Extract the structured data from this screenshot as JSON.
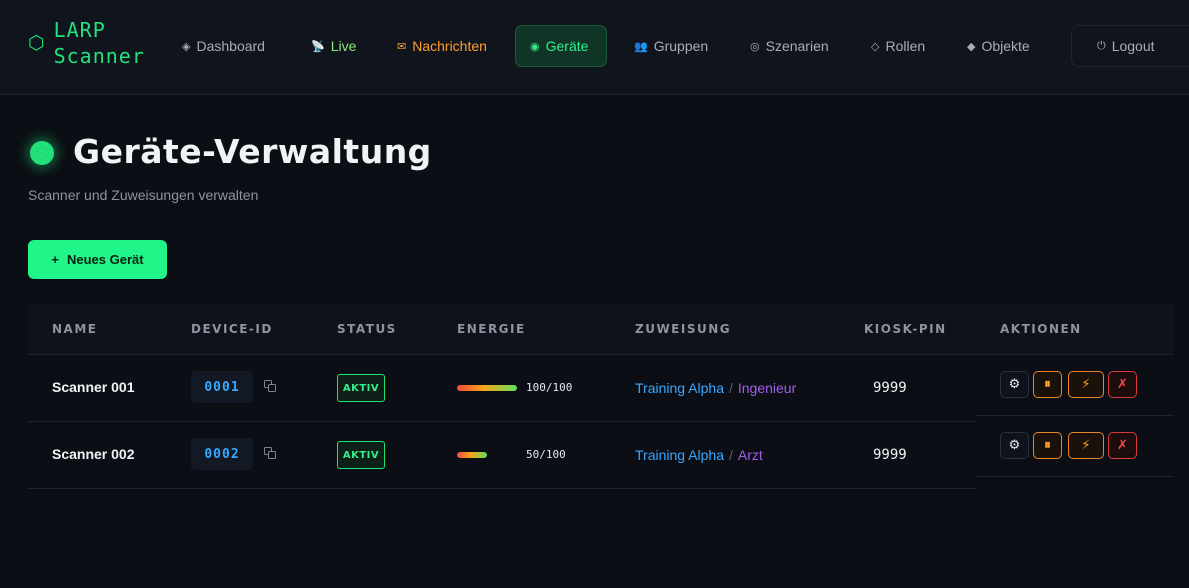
{
  "brand": {
    "line1": "LARP",
    "line2": "Scanner"
  },
  "nav": {
    "items": [
      {
        "key": "dashboard",
        "label": "Dashboard",
        "icon": "◈"
      },
      {
        "key": "live",
        "label": "Live",
        "icon": "📡"
      },
      {
        "key": "nachrichten",
        "label": "Nachrichten",
        "icon": "✉"
      },
      {
        "key": "geraete",
        "label": "Geräte",
        "icon": "◉"
      },
      {
        "key": "gruppen",
        "label": "Gruppen",
        "icon": "👥"
      },
      {
        "key": "szenarien",
        "label": "Szenarien",
        "icon": "◎"
      },
      {
        "key": "rollen",
        "label": "Rollen",
        "icon": "◇"
      },
      {
        "key": "objekte",
        "label": "Objekte",
        "icon": "◆"
      }
    ],
    "logout": {
      "label": "Logout",
      "icon": "⏻"
    },
    "active": "geraete"
  },
  "header": {
    "title": "Geräte-Verwaltung",
    "subtitle": "Scanner und Zuweisungen verwalten"
  },
  "actions": {
    "new_device": "Neues Gerät",
    "new_device_icon": "+"
  },
  "table": {
    "columns": [
      "NAME",
      "DEVICE-ID",
      "STATUS",
      "ENERGIE",
      "ZUWEISUNG",
      "KIOSK-PIN",
      "AKTIONEN"
    ],
    "rows": [
      {
        "name": "Scanner 001",
        "device_id": "0001",
        "status": "AKTIV",
        "energy": 1.0,
        "energy_text": "100/100",
        "scenario": "Training Alpha",
        "separator": "/",
        "role": "Ingenieur",
        "pin": "9999"
      },
      {
        "name": "Scanner 002",
        "device_id": "0002",
        "status": "AKTIV",
        "energy": 0.5,
        "energy_text": "50/100",
        "scenario": "Training Alpha",
        "separator": "/",
        "role": "Arzt",
        "pin": "9999"
      }
    ],
    "action_icons": {
      "settings": "⚙",
      "pause": "⏸",
      "power": "⚡",
      "delete": "✗"
    }
  },
  "colors": {
    "accent": "#22e07a",
    "scenario": "#3aa8ff",
    "role": "#a55cf0",
    "warning": "#ff9f2e",
    "danger": "#ff4848"
  }
}
